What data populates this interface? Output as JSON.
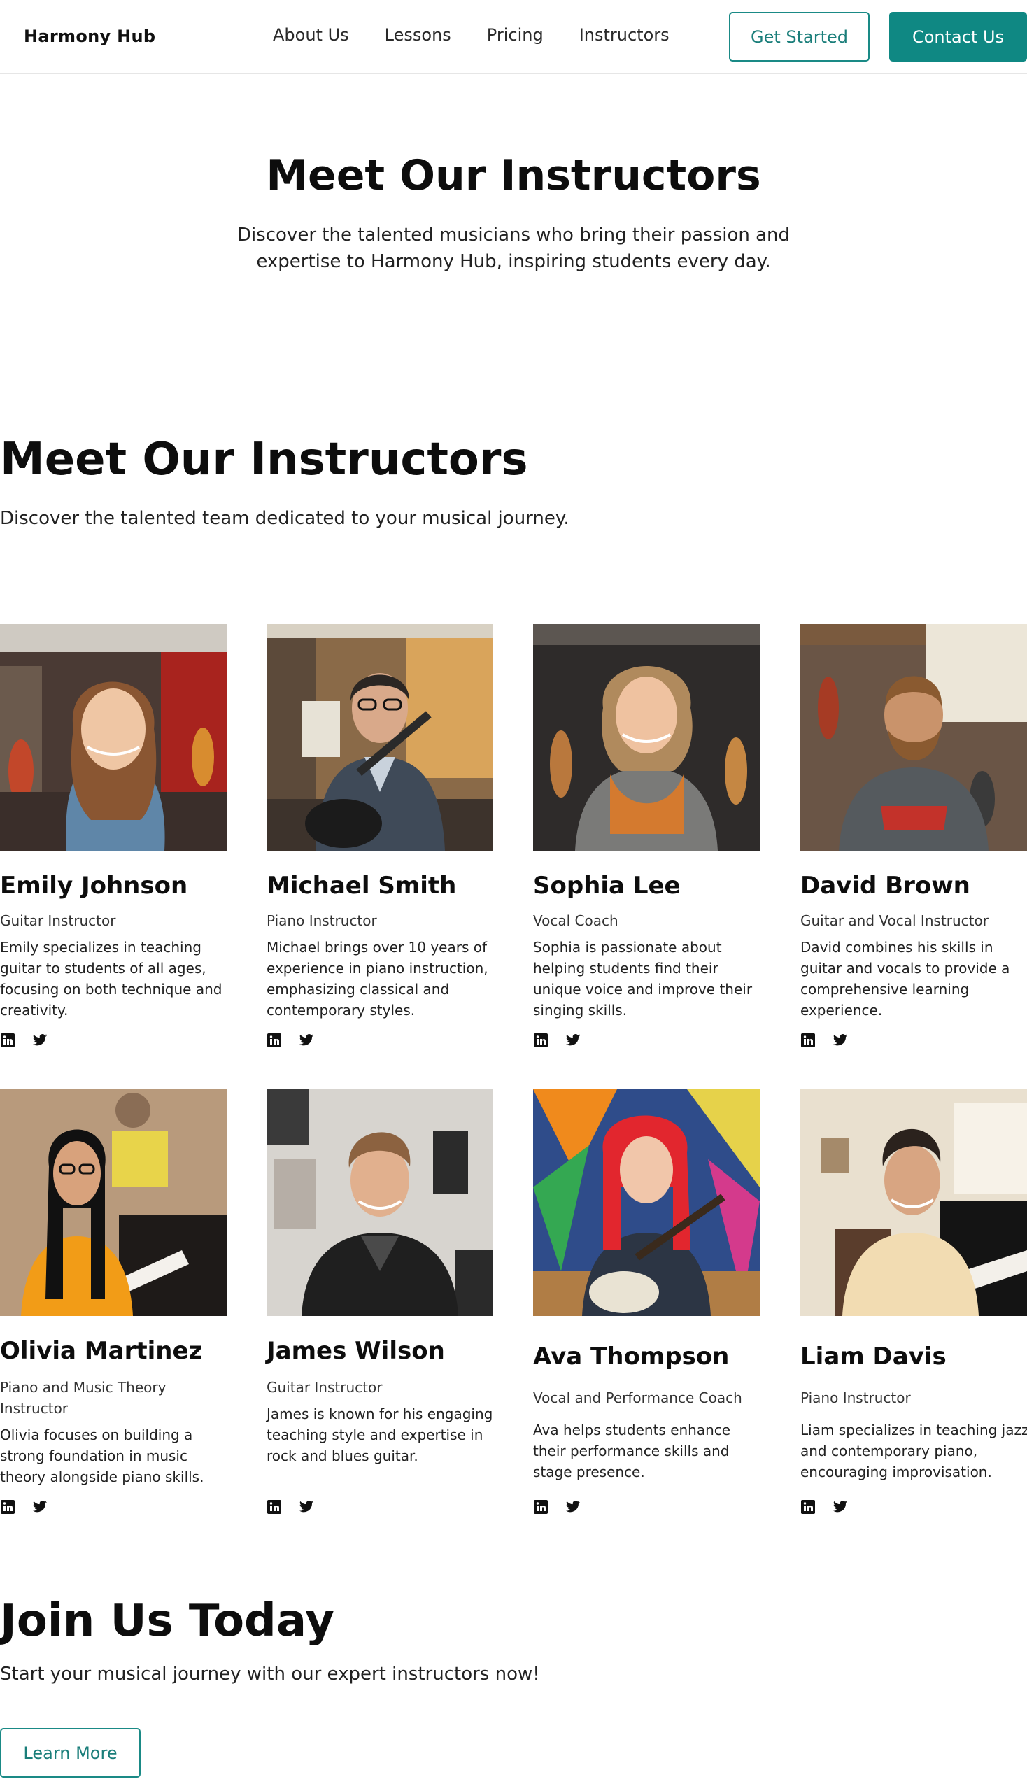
{
  "brand": {
    "logo_text": "Harmony Hub",
    "accent": "#0f8883"
  },
  "nav": {
    "links": [
      "About Us",
      "Lessons",
      "Pricing",
      "Instructors"
    ],
    "get_started": "Get Started",
    "contact": "Contact Us"
  },
  "hero": {
    "title": "Meet Our Instructors",
    "subtitle": "Discover the talented musicians who bring their passion and expertise to Harmony Hub, inspiring students every day."
  },
  "team": {
    "title": "Meet Our Instructors",
    "subtitle": "Discover the talented team dedicated to your musical journey.",
    "instructors": [
      {
        "name": "Emily Johnson",
        "role": "Guitar Instructor",
        "bio": "Emily specializes in teaching guitar to students of all ages, focusing on both technique and creativity.",
        "icons": [
          "linkedin-icon",
          "twitter-icon"
        ]
      },
      {
        "name": "Michael Smith",
        "role": "Piano Instructor",
        "bio": "Michael brings over 10 years of experience in piano instruction, emphasizing classical and contemporary styles.",
        "icons": [
          "linkedin-icon",
          "twitter-icon"
        ]
      },
      {
        "name": "Sophia Lee",
        "role": "Vocal Coach",
        "bio": "Sophia is passionate about helping students find their unique voice and improve their singing skills.",
        "icons": [
          "linkedin-icon",
          "twitter-icon"
        ]
      },
      {
        "name": "David Brown",
        "role": "Guitar and Vocal Instructor",
        "bio": "David combines his skills in guitar and vocals to provide a comprehensive learning experience.",
        "icons": [
          "linkedin-icon",
          "twitter-icon"
        ]
      },
      {
        "name": "Olivia Martinez",
        "role": "Piano and Music Theory Instructor",
        "bio": "Olivia focuses on building a strong foundation in music theory alongside piano skills.",
        "icons": [
          "linkedin-icon",
          "twitter-icon"
        ]
      },
      {
        "name": "James Wilson",
        "role": "Guitar Instructor",
        "bio": "James is known for his engaging teaching style and expertise in rock and blues guitar.",
        "icons": [
          "linkedin-icon",
          "twitter-icon"
        ]
      },
      {
        "name": "Ava Thompson",
        "role": "Vocal and Performance Coach",
        "bio": "Ava helps students enhance their performance skills and stage presence.",
        "icons": [
          "linkedin-icon",
          "twitter-icon"
        ]
      },
      {
        "name": "Liam Davis",
        "role": "Piano Instructor",
        "bio": "Liam specializes in teaching jazz and contemporary piano, encouraging improvisation.",
        "icons": [
          "linkedin-icon",
          "twitter-icon"
        ]
      }
    ]
  },
  "join": {
    "title": "Join Us Today",
    "subtitle": "Start your musical journey with our expert instructors now!",
    "button": "Learn More"
  }
}
